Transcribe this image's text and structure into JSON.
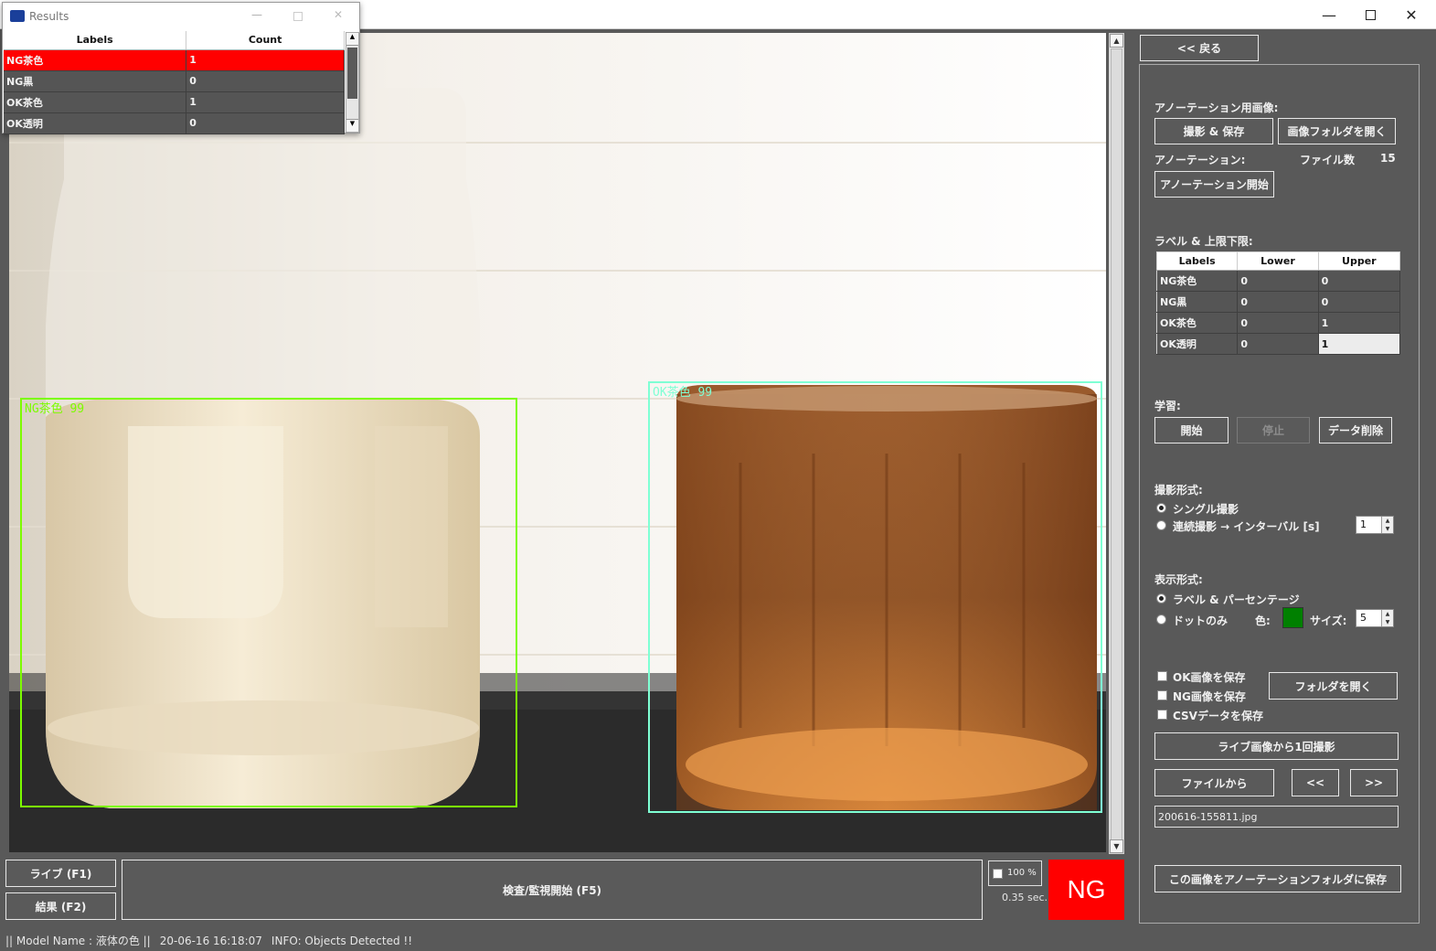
{
  "window": {
    "minimize_icon": "minimize-icon",
    "maximize_icon": "maximize-icon",
    "close_icon": "close-icon"
  },
  "results_window": {
    "title": "Results",
    "columns": [
      "Labels",
      "Count"
    ],
    "rows": [
      {
        "label": "NG茶色",
        "count": "1"
      },
      {
        "label": "NG黒",
        "count": "0"
      },
      {
        "label": "OK茶色",
        "count": "1"
      },
      {
        "label": "OK透明",
        "count": "0"
      }
    ]
  },
  "detections": [
    {
      "label": "NG茶色 99",
      "color": "#7cfc00"
    },
    {
      "label": "OK茶色 99",
      "color": "#7fffd4"
    }
  ],
  "panel": {
    "back_button": "<< 戻る",
    "annotation_image_label": "アノーテーション用画像:",
    "capture_save_button": "撮影 & 保存",
    "open_image_folder_button": "画像フォルダを開く",
    "annotation_label": "アノーテーション:",
    "file_count_label": "ファイル数",
    "file_count_value": "15",
    "start_annotation_button": "アノーテーション開始",
    "label_limits_label": "ラベル & 上限下限:",
    "limits_columns": [
      "Labels",
      "Lower",
      "Upper"
    ],
    "limits_rows": [
      {
        "label": "NG茶色",
        "lower": "0",
        "upper": "0"
      },
      {
        "label": "NG黒",
        "lower": "0",
        "upper": "0"
      },
      {
        "label": "OK茶色",
        "lower": "0",
        "upper": "1"
      },
      {
        "label": "OK透明",
        "lower": "0",
        "upper": "1"
      }
    ],
    "learning_label": "学習:",
    "start_button": "開始",
    "stop_button": "停止",
    "delete_data_button": "データ削除",
    "capture_mode_label": "撮影形式:",
    "single_capture": "シングル撮影",
    "continuous_capture": "連続撮影 → インターバル [s]",
    "interval_value": "1",
    "display_mode_label": "表示形式:",
    "label_percentage": "ラベル & パーセンテージ",
    "dot_only": "ドットのみ",
    "color_label": "色:",
    "dot_color": "#008000",
    "size_label": "サイズ:",
    "size_value": "5",
    "save_ok_image": "OK画像を保存",
    "save_ng_image": "NG画像を保存",
    "save_csv": "CSVデータを保存",
    "open_folder_button": "フォルダを開く",
    "capture_from_live_button": "ライブ画像から1回撮影",
    "from_file_button": "ファイルから",
    "prev_button": "<<",
    "next_button": ">>",
    "filename_value": "200616-155811.jpg",
    "save_to_annotation_button": "この画像をアノーテーションフォルダに保存"
  },
  "bottom": {
    "live_button": "ライブ (F1)",
    "result_button": "結果 (F2)",
    "inspect_button": "検査/監視開始 (F5)",
    "zoom_value": "100 %",
    "time_value": "0.35 sec.",
    "verdict": "NG",
    "verdict_color": "#ff0000"
  },
  "status": {
    "model": "|| Model Name : 液体の色 ||",
    "timestamp": "20-06-16 16:18:07",
    "info": "INFO:  Objects Detected !!"
  }
}
